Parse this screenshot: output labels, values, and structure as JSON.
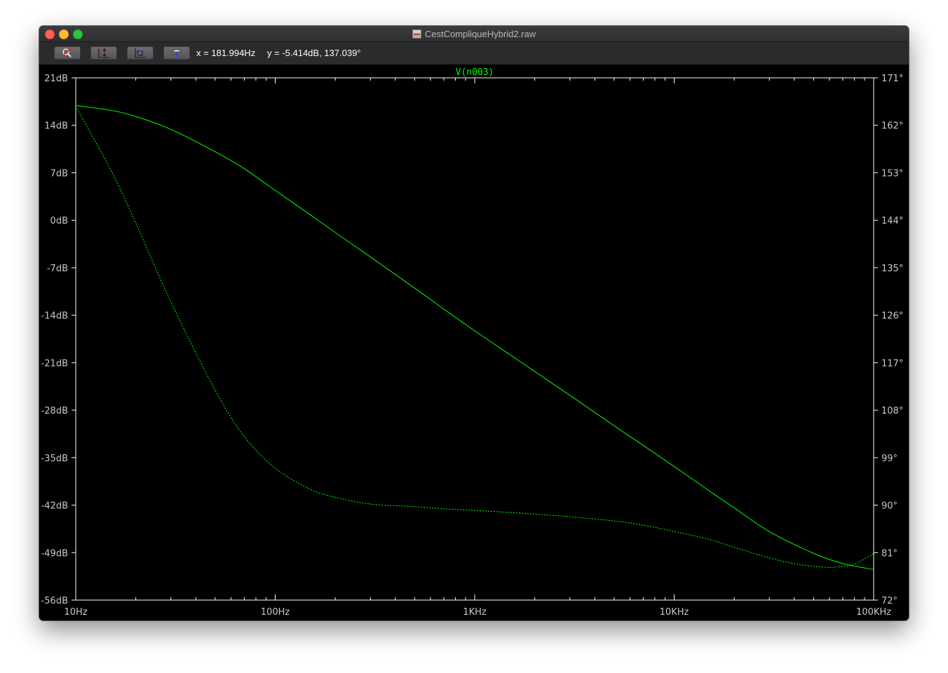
{
  "window": {
    "title": "CestCompliqueHybrid2.raw",
    "title_icon": "waveform-file-icon"
  },
  "toolbar": {
    "buttons": [
      {
        "name": "zoom-cancel-button",
        "icon": "magnifier-cancel-icon"
      },
      {
        "name": "autorange-y-button",
        "icon": "vertical-autorange-icon"
      },
      {
        "name": "zoom-area-button",
        "icon": "zoom-area-icon"
      },
      {
        "name": "probe-button",
        "icon": "probe-hammer-icon"
      }
    ],
    "x_readout": "x = 181.994Hz",
    "y_readout": "y = -5.414dB, 137.039°"
  },
  "chart_data": {
    "type": "line",
    "title": "V(n003)",
    "x_scale": "log",
    "xlim": [
      10,
      100000
    ],
    "x_ticks": [
      10,
      100,
      1000,
      10000,
      100000
    ],
    "x_tick_labels": [
      "10Hz",
      "100Hz",
      "1KHz",
      "10KHz",
      "100KHz"
    ],
    "y_left": {
      "unit": "dB",
      "ylim": [
        -56,
        21
      ],
      "ticks": [
        21,
        14,
        7,
        0,
        -7,
        -14,
        -21,
        -28,
        -35,
        -42,
        -49,
        -56
      ],
      "tick_labels": [
        "21dB",
        "14dB",
        "7dB",
        "0dB",
        "-7dB",
        "-14dB",
        "-21dB",
        "-28dB",
        "-35dB",
        "-42dB",
        "-49dB",
        "-56dB"
      ]
    },
    "y_right": {
      "unit": "°",
      "ylim": [
        72,
        171
      ],
      "ticks": [
        171,
        162,
        153,
        144,
        135,
        126,
        117,
        108,
        99,
        90,
        81,
        72
      ],
      "tick_labels": [
        "171°",
        "162°",
        "153°",
        "144°",
        "135°",
        "126°",
        "117°",
        "108°",
        "99°",
        "90°",
        "81°",
        "72°"
      ]
    },
    "grid": false,
    "series": [
      {
        "style": "solid",
        "axis": "left",
        "x": [
          10,
          15,
          20,
          30,
          50,
          70,
          100,
          150,
          200,
          300,
          500,
          700,
          1000,
          1500,
          2000,
          3000,
          5000,
          7000,
          10000,
          15000,
          20000,
          30000,
          50000,
          70000,
          100000
        ],
        "y": [
          16.9,
          16.2,
          15.3,
          13.4,
          10.1,
          7.6,
          4.4,
          0.8,
          -1.8,
          -5.4,
          -10.0,
          -13.1,
          -16.3,
          -19.8,
          -22.3,
          -25.8,
          -30.3,
          -33.2,
          -36.3,
          -39.9,
          -42.4,
          -45.9,
          -49.1,
          -50.6,
          -51.5
        ]
      },
      {
        "style": "dashed",
        "axis": "right",
        "x": [
          10,
          15,
          20,
          30,
          50,
          70,
          100,
          150,
          200,
          300,
          500,
          700,
          1000,
          1500,
          2000,
          3000,
          5000,
          7000,
          10000,
          15000,
          20000,
          30000,
          40000,
          50000,
          60000,
          70000,
          80000,
          100000
        ],
        "y": [
          165.6,
          153.5,
          143.5,
          128.5,
          111.8,
          103.0,
          97.0,
          93.0,
          91.5,
          90.2,
          89.7,
          89.3,
          89.0,
          88.6,
          88.3,
          87.8,
          87.0,
          86.2,
          85.0,
          83.5,
          82.0,
          80.0,
          78.9,
          78.4,
          78.2,
          78.4,
          78.8,
          80.8
        ]
      }
    ]
  },
  "colors": {
    "background": "#000000",
    "frame": "#ffffff",
    "trace": "#00ff00",
    "axis_text": "#c8c8c8"
  }
}
